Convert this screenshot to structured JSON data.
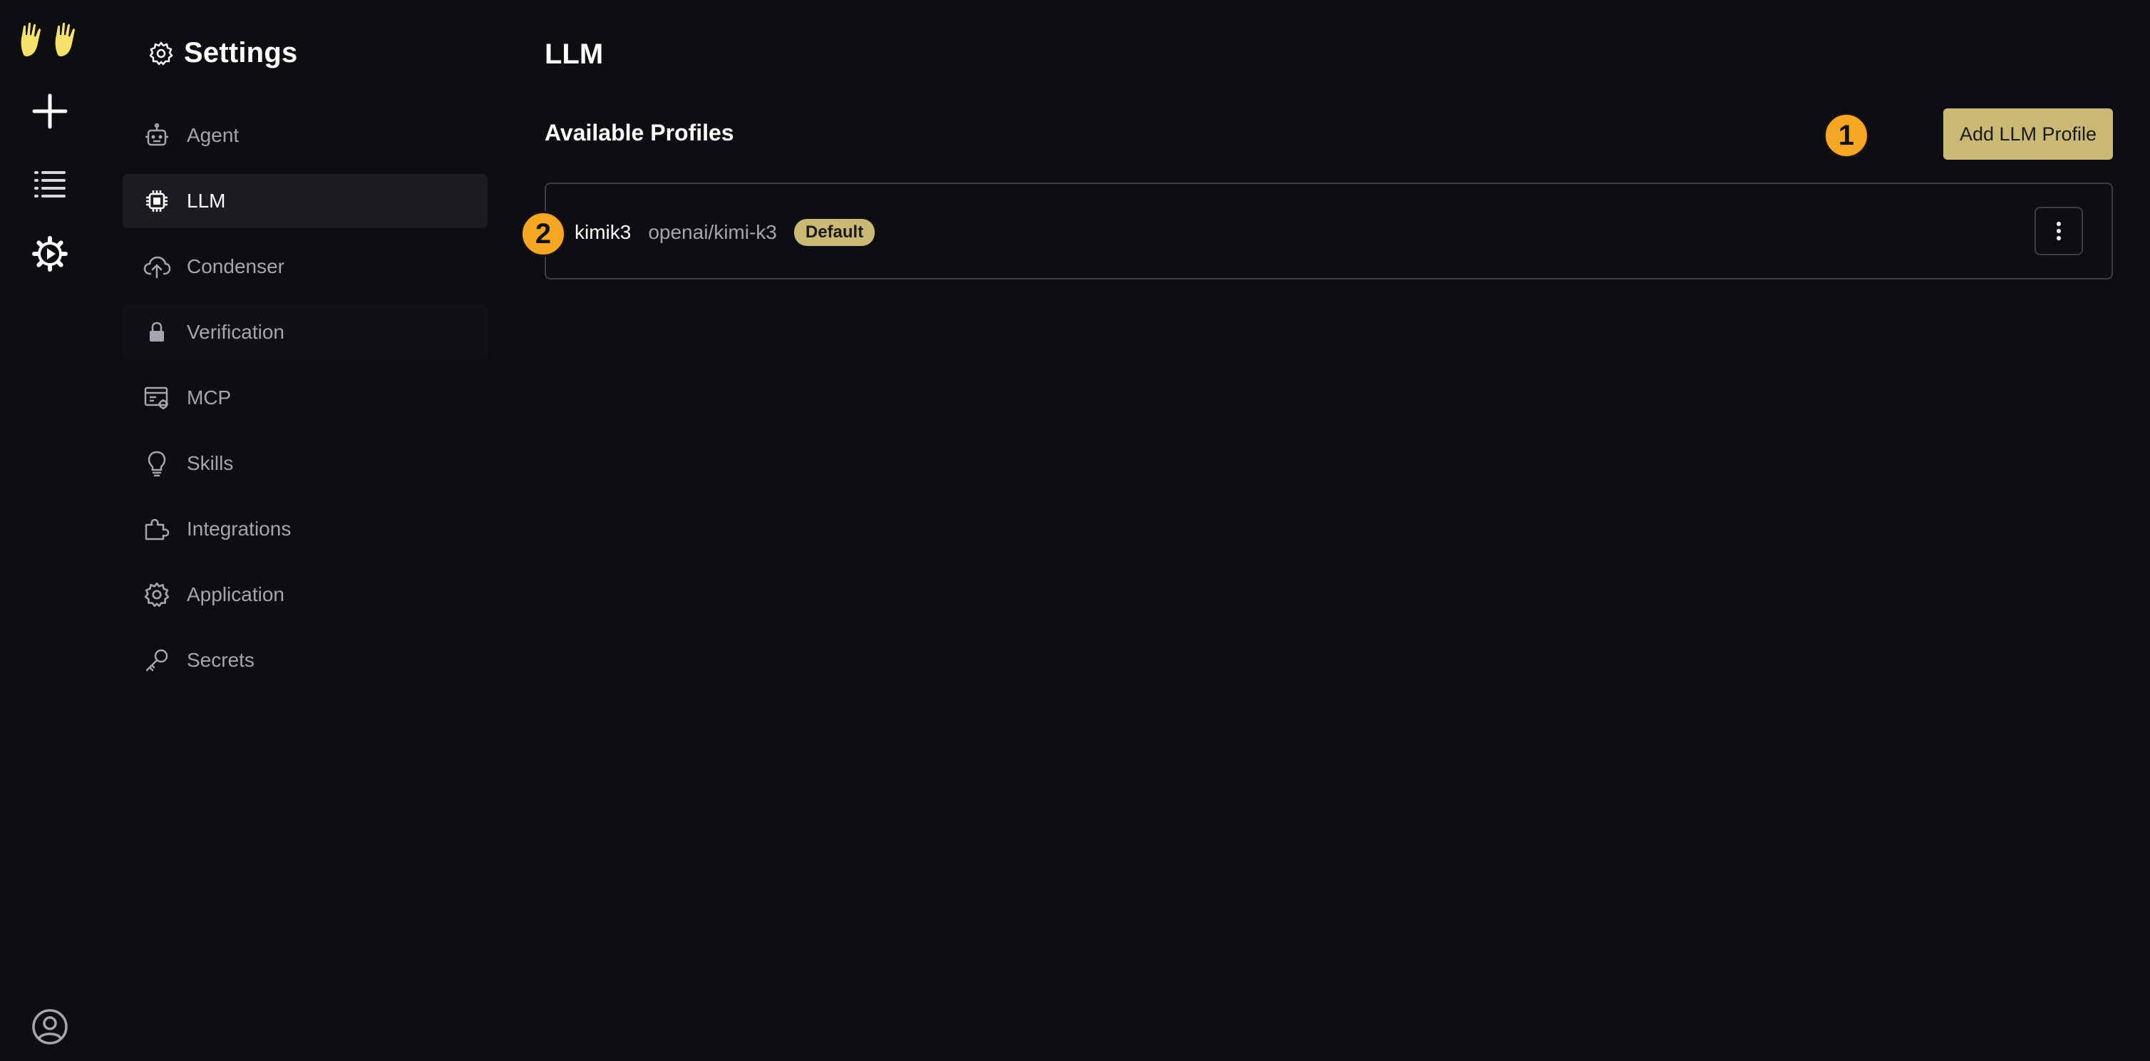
{
  "rail": {
    "logo": "raised-hands-logo",
    "items": [
      {
        "name": "new-conversation",
        "icon": "plus-icon"
      },
      {
        "name": "conversations-list",
        "icon": "list-icon"
      },
      {
        "name": "settings",
        "icon": "gear-play-icon"
      }
    ],
    "user": "user-avatar-icon"
  },
  "nav": {
    "title": "Settings",
    "items": [
      {
        "label": "Agent",
        "icon": "robot-icon"
      },
      {
        "label": "LLM",
        "icon": "chip-icon",
        "active": true
      },
      {
        "label": "Condenser",
        "icon": "cloud-upload-icon"
      },
      {
        "label": "Verification",
        "icon": "lock-icon"
      },
      {
        "label": "MCP",
        "icon": "server-icon"
      },
      {
        "label": "Skills",
        "icon": "lightbulb-icon"
      },
      {
        "label": "Integrations",
        "icon": "puzzle-icon"
      },
      {
        "label": "Application",
        "icon": "gear-icon"
      },
      {
        "label": "Secrets",
        "icon": "key-icon"
      }
    ]
  },
  "main": {
    "title": "LLM",
    "section_title": "Available Profiles",
    "add_button": "Add LLM Profile",
    "annotations": [
      "1",
      "2"
    ],
    "profiles": [
      {
        "name": "kimik3",
        "model": "openai/kimi-k3",
        "badge": "Default"
      }
    ]
  },
  "colors": {
    "background": "#0c0e11",
    "accent": "#c9b974",
    "annotation": "#f5a623",
    "border": "#3a3d42",
    "muted_text": "#a3a7ad"
  }
}
